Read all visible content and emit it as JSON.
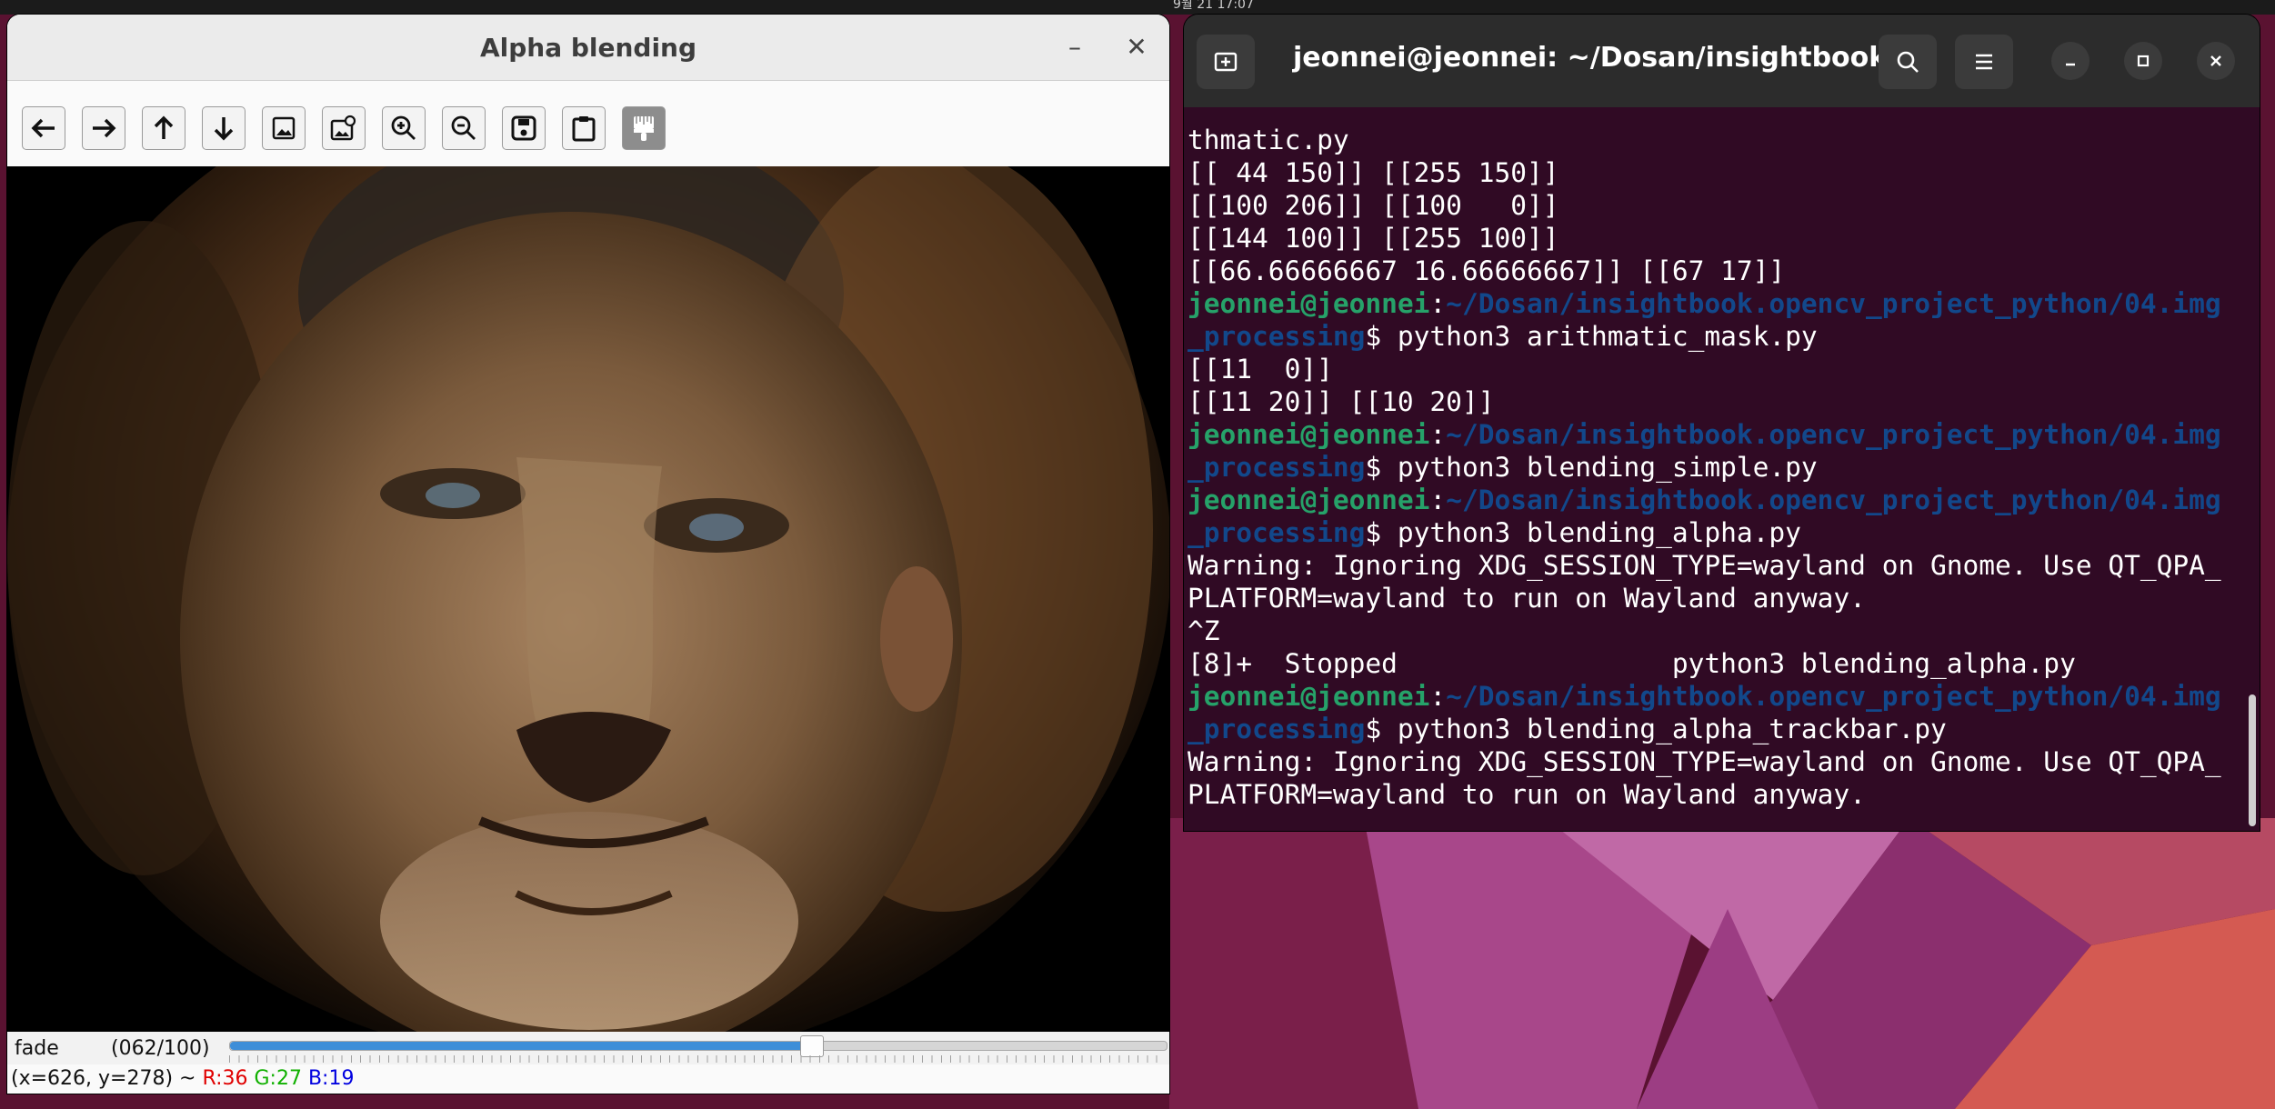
{
  "top_bar": {
    "clock_fragment": "9월 21 17:07"
  },
  "cv_window": {
    "title": "Alpha blending",
    "controls": {
      "minimize": "–",
      "close": "✕"
    },
    "toolbar": [
      {
        "name": "pan-left-icon",
        "tooltip": "Pan left"
      },
      {
        "name": "pan-right-icon",
        "tooltip": "Pan right"
      },
      {
        "name": "pan-up-icon",
        "tooltip": "Pan up"
      },
      {
        "name": "pan-down-icon",
        "tooltip": "Pan down"
      },
      {
        "name": "zoom-original-icon",
        "tooltip": "Zoom x1"
      },
      {
        "name": "zoom-fit-icon",
        "tooltip": "Zoom fit"
      },
      {
        "name": "zoom-in-icon",
        "tooltip": "Zoom in"
      },
      {
        "name": "zoom-out-icon",
        "tooltip": "Zoom out"
      },
      {
        "name": "save-icon",
        "tooltip": "Save"
      },
      {
        "name": "properties-icon",
        "tooltip": "Properties"
      },
      {
        "name": "paint-brush-icon",
        "tooltip": "Brush"
      }
    ],
    "trackbar": {
      "name": "fade",
      "value_text": "(062/100)",
      "value": 62,
      "max": 100
    },
    "status": {
      "coords": "(x=626, y=278) ~",
      "r": "R:36",
      "g": "G:27",
      "b": "B:19"
    }
  },
  "terminal": {
    "title": "jeonnei@jeonnei: ~/Dosan/insightbook....",
    "prompt_user": "jeonnei@jeonnei",
    "lines": [
      {
        "type": "out",
        "text": "thmatic.py"
      },
      {
        "type": "out",
        "text": "[[ 44 150]] [[255 150]]"
      },
      {
        "type": "out",
        "text": "[[100 206]] [[100   0]]"
      },
      {
        "type": "out",
        "text": "[[144 100]] [[255 100]]"
      },
      {
        "type": "out",
        "text": "[[66.66666667 16.66666667]] [[67 17]]"
      },
      {
        "type": "prompt",
        "user": "jeonnei@jeonnei",
        "sep": ":",
        "path1": "~/Dosan/insightbook.opencv_project_python/04.img",
        "path2": "_processing",
        "cmd": "$ python3 arithmatic_mask.py"
      },
      {
        "type": "out",
        "text": "[[11  0]]"
      },
      {
        "type": "out",
        "text": "[[11 20]] [[10 20]]"
      },
      {
        "type": "prompt",
        "user": "jeonnei@jeonnei",
        "sep": ":",
        "path1": "~/Dosan/insightbook.opencv_project_python/04.img",
        "path2": "_processing",
        "cmd": "$ python3 blending_simple.py"
      },
      {
        "type": "prompt",
        "user": "jeonnei@jeonnei",
        "sep": ":",
        "path1": "~/Dosan/insightbook.opencv_project_python/04.img",
        "path2": "_processing",
        "cmd": "$ python3 blending_alpha.py"
      },
      {
        "type": "out",
        "text": "Warning: Ignoring XDG_SESSION_TYPE=wayland on Gnome. Use QT_QPA_"
      },
      {
        "type": "out",
        "text": "PLATFORM=wayland to run on Wayland anyway."
      },
      {
        "type": "out",
        "text": "^Z"
      },
      {
        "type": "out",
        "text": "[8]+  Stopped                 python3 blending_alpha.py"
      },
      {
        "type": "prompt",
        "user": "jeonnei@jeonnei",
        "sep": ":",
        "path1": "~/Dosan/insightbook.opencv_project_python/04.img",
        "path2": "_processing",
        "cmd": "$ python3 blending_alpha_trackbar.py"
      },
      {
        "type": "out",
        "text": "Warning: Ignoring XDG_SESSION_TYPE=wayland on Gnome. Use QT_QPA_"
      },
      {
        "type": "out",
        "text": "PLATFORM=wayland to run on Wayland anyway."
      }
    ]
  },
  "colors": {
    "terminal_bg": "#300a24",
    "prompt_user": "#26a269",
    "prompt_path": "#12488b",
    "trackbar_fill": "#3d8ed8"
  }
}
